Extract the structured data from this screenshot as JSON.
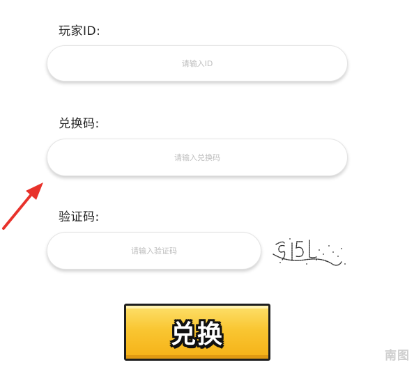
{
  "form": {
    "player_id": {
      "label": "玩家ID:",
      "placeholder": "请输入ID",
      "value": ""
    },
    "redeem_code": {
      "label": "兑换码:",
      "placeholder": "请输入兑换码",
      "value": ""
    },
    "verify_code": {
      "label": "验证码:",
      "placeholder": "请输入验证码",
      "value": "",
      "captcha_text": "9151"
    },
    "submit_label": "兑换"
  },
  "annotation": {
    "arrow_color": "#e8322b"
  },
  "watermark": "南图"
}
